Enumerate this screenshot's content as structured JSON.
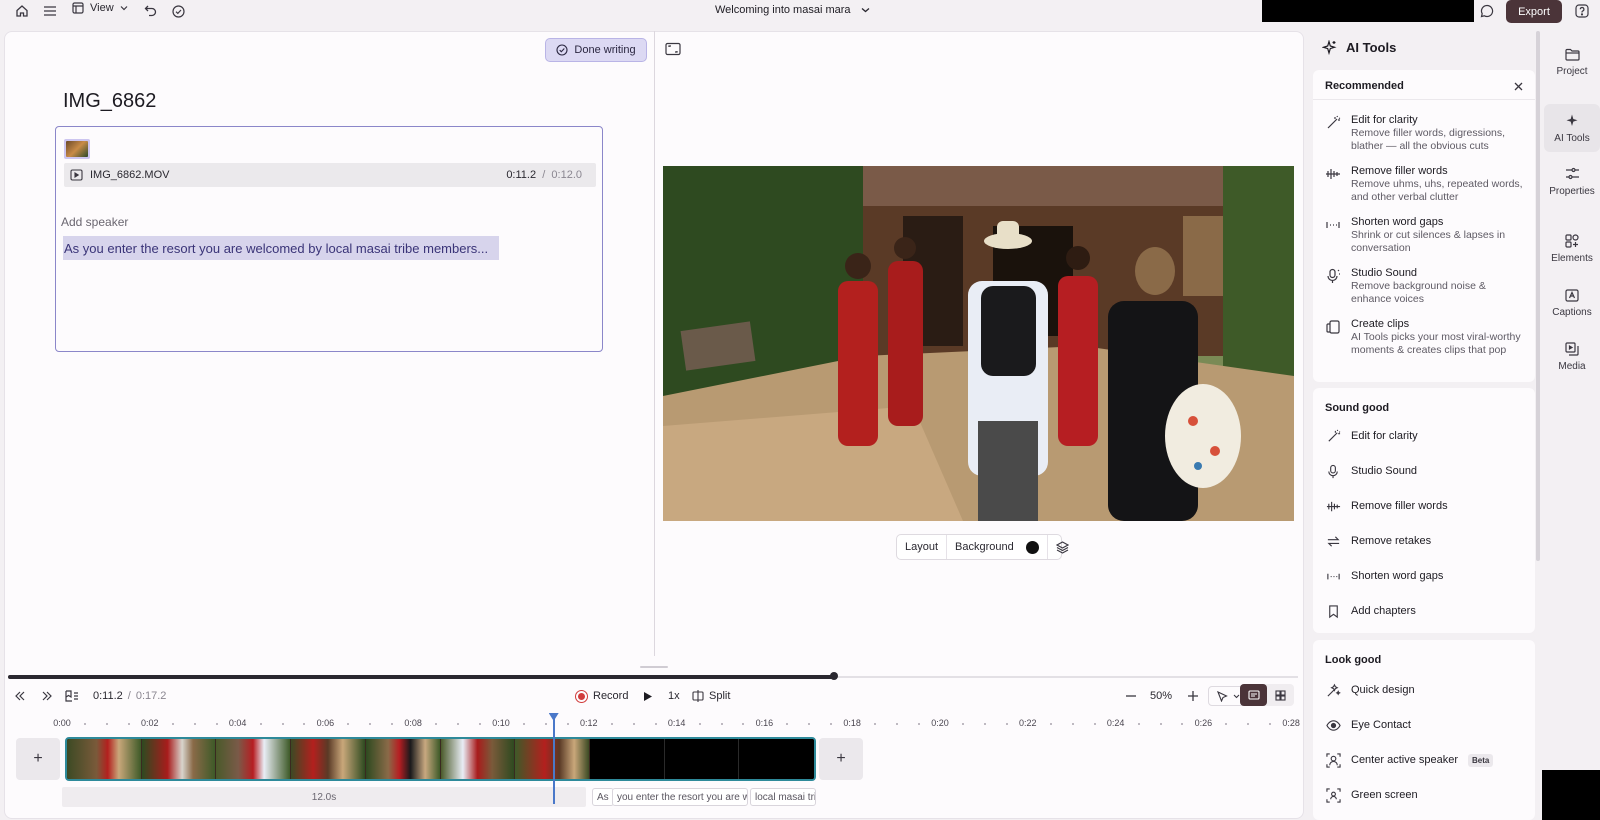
{
  "topbar": {
    "view_label": "View",
    "project_title": "Welcoming into masai mara",
    "export_label": "Export"
  },
  "editor": {
    "done_writing_label": "Done writing",
    "doc_title": "IMG_6862",
    "clip_filename": "IMG_6862.MOV",
    "clip_time_current": "0:11.2",
    "clip_time_sep": "/",
    "clip_time_total": "0:12.0",
    "add_speaker_label": "Add speaker",
    "script_text": "As you enter the resort you are welcomed by local masai tribe members..."
  },
  "preview": {
    "layout_label": "Layout",
    "background_label": "Background",
    "background_color": "#111111"
  },
  "timeline": {
    "progress": 0.64,
    "time_current": "0:11.2",
    "time_sep": "/",
    "time_total": "0:17.2",
    "record_label": "Record",
    "speed_label": "1x",
    "split_label": "Split",
    "zoom_label": "50%",
    "ruler_ticks": [
      "0:00",
      "0:02",
      "0:04",
      "0:06",
      "0:08",
      "0:10",
      "0:12",
      "0:14",
      "0:16",
      "0:18",
      "0:20",
      "0:22",
      "0:24",
      "0:26",
      "0:28"
    ],
    "playhead_seconds": 11.2,
    "seconds_per_tick": 2,
    "gap_label": "12.0s",
    "subtitle_chunks": [
      "As",
      "you enter the resort you are wel",
      "local masai trib"
    ]
  },
  "ai_panel": {
    "title": "AI Tools",
    "recommended": {
      "title": "Recommended",
      "items": [
        {
          "icon": "magic-wand-icon",
          "title": "Edit for clarity",
          "desc": "Remove filler words, digressions, blather — all the obvious cuts"
        },
        {
          "icon": "filler-words-icon",
          "title": "Remove filler words",
          "desc": "Remove uhms, uhs, repeated words, and other verbal clutter"
        },
        {
          "icon": "word-gap-icon",
          "title": "Shorten word gaps",
          "desc": "Shrink or cut silences & lapses in conversation"
        },
        {
          "icon": "studio-mic-icon",
          "title": "Studio Sound",
          "desc": "Remove background noise & enhance voices"
        },
        {
          "icon": "create-clips-icon",
          "title": "Create clips",
          "desc": "AI Tools picks your most viral-worthy moments & creates clips that pop"
        }
      ]
    },
    "sound_good": {
      "title": "Sound good",
      "items": [
        {
          "icon": "magic-wand-icon",
          "label": "Edit for clarity"
        },
        {
          "icon": "studio-mic-icon",
          "label": "Studio Sound"
        },
        {
          "icon": "filler-words-icon",
          "label": "Remove filler words"
        },
        {
          "icon": "retakes-icon",
          "label": "Remove retakes"
        },
        {
          "icon": "word-gap-icon",
          "label": "Shorten word gaps"
        },
        {
          "icon": "bookmark-icon",
          "label": "Add chapters"
        }
      ]
    },
    "look_good": {
      "title": "Look good",
      "items": [
        {
          "icon": "quick-design-icon",
          "label": "Quick design"
        },
        {
          "icon": "eye-icon",
          "label": "Eye Contact"
        },
        {
          "icon": "center-speaker-icon",
          "label": "Center active speaker",
          "badge": "Beta"
        },
        {
          "icon": "green-screen-icon",
          "label": "Green screen"
        }
      ]
    }
  },
  "rail": {
    "items": [
      {
        "icon": "folder-icon",
        "label": "Project",
        "active": false
      },
      {
        "icon": "sparkle-icon",
        "label": "AI Tools",
        "active": true
      },
      {
        "icon": "sliders-icon",
        "label": "Properties",
        "active": false
      },
      {
        "icon": "shapes-icon",
        "label": "Elements",
        "active": false
      },
      {
        "icon": "captions-icon",
        "label": "Captions",
        "active": false
      },
      {
        "icon": "media-icon",
        "label": "Media",
        "active": false
      }
    ]
  },
  "colors": {
    "accent": "#4b3439",
    "selection": "#d7d4ec",
    "playhead": "#4a78c9",
    "record": "#d13b3b",
    "clip_border": "#2e8a9a"
  }
}
